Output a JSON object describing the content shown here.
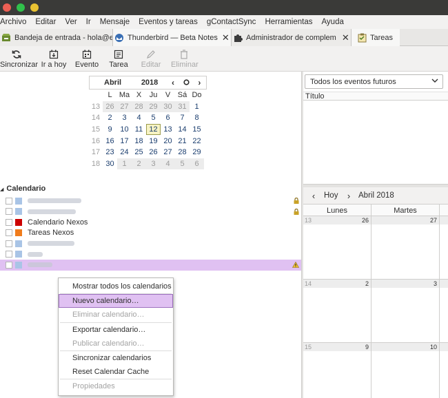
{
  "menubar": {
    "items": [
      "Archivo",
      "Editar",
      "Ver",
      "Ir",
      "Mensaje",
      "Eventos y tareas",
      "gContactSync",
      "Herramientas",
      "Ayuda"
    ]
  },
  "tabs": [
    {
      "label": "Bandeja de entrada - hola@est",
      "icon": "inbox-icon"
    },
    {
      "label": "Thunderbird — Beta Notes",
      "icon": "thunderbird-icon"
    },
    {
      "label": "Administrador de complem",
      "icon": "puzzle-icon"
    },
    {
      "label": "Tareas",
      "icon": "tasks-icon"
    }
  ],
  "toolbar": {
    "sync": "Sincronizar",
    "goto_today": "Ir a hoy",
    "event": "Evento",
    "task": "Tarea",
    "edit": "Editar",
    "delete": "Eliminar"
  },
  "minimonth": {
    "month": "Abril",
    "year": "2018",
    "daynames": [
      "L",
      "Ma",
      "X",
      "Ju",
      "V",
      "Sá",
      "Do"
    ],
    "weeks": [
      {
        "wk": "13",
        "days": [
          "26",
          "27",
          "28",
          "29",
          "30",
          "31",
          "1"
        ],
        "other": [
          true,
          true,
          true,
          true,
          true,
          true,
          false
        ]
      },
      {
        "wk": "14",
        "days": [
          "2",
          "3",
          "4",
          "5",
          "6",
          "7",
          "8"
        ],
        "other": [
          false,
          false,
          false,
          false,
          false,
          false,
          false
        ]
      },
      {
        "wk": "15",
        "days": [
          "9",
          "10",
          "11",
          "12",
          "13",
          "14",
          "15"
        ],
        "other": [
          false,
          false,
          false,
          false,
          false,
          false,
          false
        ]
      },
      {
        "wk": "16",
        "days": [
          "16",
          "17",
          "18",
          "19",
          "20",
          "21",
          "22"
        ],
        "other": [
          false,
          false,
          false,
          false,
          false,
          false,
          false
        ]
      },
      {
        "wk": "17",
        "days": [
          "23",
          "24",
          "25",
          "26",
          "27",
          "28",
          "29"
        ],
        "other": [
          false,
          false,
          false,
          false,
          false,
          false,
          false
        ]
      },
      {
        "wk": "18",
        "days": [
          "30",
          "1",
          "2",
          "3",
          "4",
          "5",
          "6"
        ],
        "other": [
          false,
          true,
          true,
          true,
          true,
          true,
          true
        ]
      }
    ],
    "today": "12"
  },
  "calendars": {
    "title": "Calendario",
    "items": [
      {
        "label": "",
        "blurred": true,
        "color": "#a9c4e6",
        "lock": true,
        "selected": false
      },
      {
        "label": "",
        "blurred": true,
        "color": "#a9c4e6",
        "lock": true,
        "selected": false
      },
      {
        "label": "Calendario Nexos",
        "blurred": false,
        "color": "#cc0000",
        "lock": false,
        "selected": false
      },
      {
        "label": "Tareas Nexos",
        "blurred": false,
        "color": "#f07c1c",
        "lock": false,
        "selected": false
      },
      {
        "label": "",
        "blurred": true,
        "color": "#a9c4e6",
        "lock": false,
        "selected": false
      },
      {
        "label": "",
        "blurred": true,
        "color": "#a9c4e6",
        "lock": false,
        "selected": false
      },
      {
        "label": "",
        "blurred": true,
        "color": "#a9c4e6",
        "lock": false,
        "selected": true,
        "warning": true
      }
    ]
  },
  "context_menu": {
    "items": [
      {
        "label": "Mostrar todos los calendarios",
        "disabled": false,
        "highlight": false
      },
      {
        "sep": true
      },
      {
        "label": "Nuevo calendario…",
        "disabled": false,
        "highlight": true
      },
      {
        "label": "Eliminar calendario…",
        "disabled": true,
        "highlight": false
      },
      {
        "sep": true
      },
      {
        "label": "Exportar calendario…",
        "disabled": false,
        "highlight": false
      },
      {
        "label": "Publicar calendario…",
        "disabled": true,
        "highlight": false
      },
      {
        "sep": true
      },
      {
        "label": "Sincronizar calendarios",
        "disabled": false,
        "highlight": false
      },
      {
        "label": "Reset Calendar Cache",
        "disabled": false,
        "highlight": false
      },
      {
        "sep": true
      },
      {
        "label": "Propiedades",
        "disabled": true,
        "highlight": false
      }
    ]
  },
  "events": {
    "filter": "Todos los eventos futuros",
    "column_title": "Título"
  },
  "monthview": {
    "today_label": "Hoy",
    "month_label": "Abril 2018",
    "columns": [
      "Lunes",
      "Martes"
    ],
    "rows": [
      {
        "wk": "13",
        "days": [
          "26",
          "27"
        ]
      },
      {
        "wk": "14",
        "days": [
          "2",
          "3"
        ]
      },
      {
        "wk": "15",
        "days": [
          "9",
          "10"
        ]
      }
    ]
  },
  "colors": {
    "selection": "#e0c1f2",
    "selection_border": "#9c6fbe",
    "link_blue": "#1a3d6e",
    "titlebar": "#3a3a38"
  }
}
